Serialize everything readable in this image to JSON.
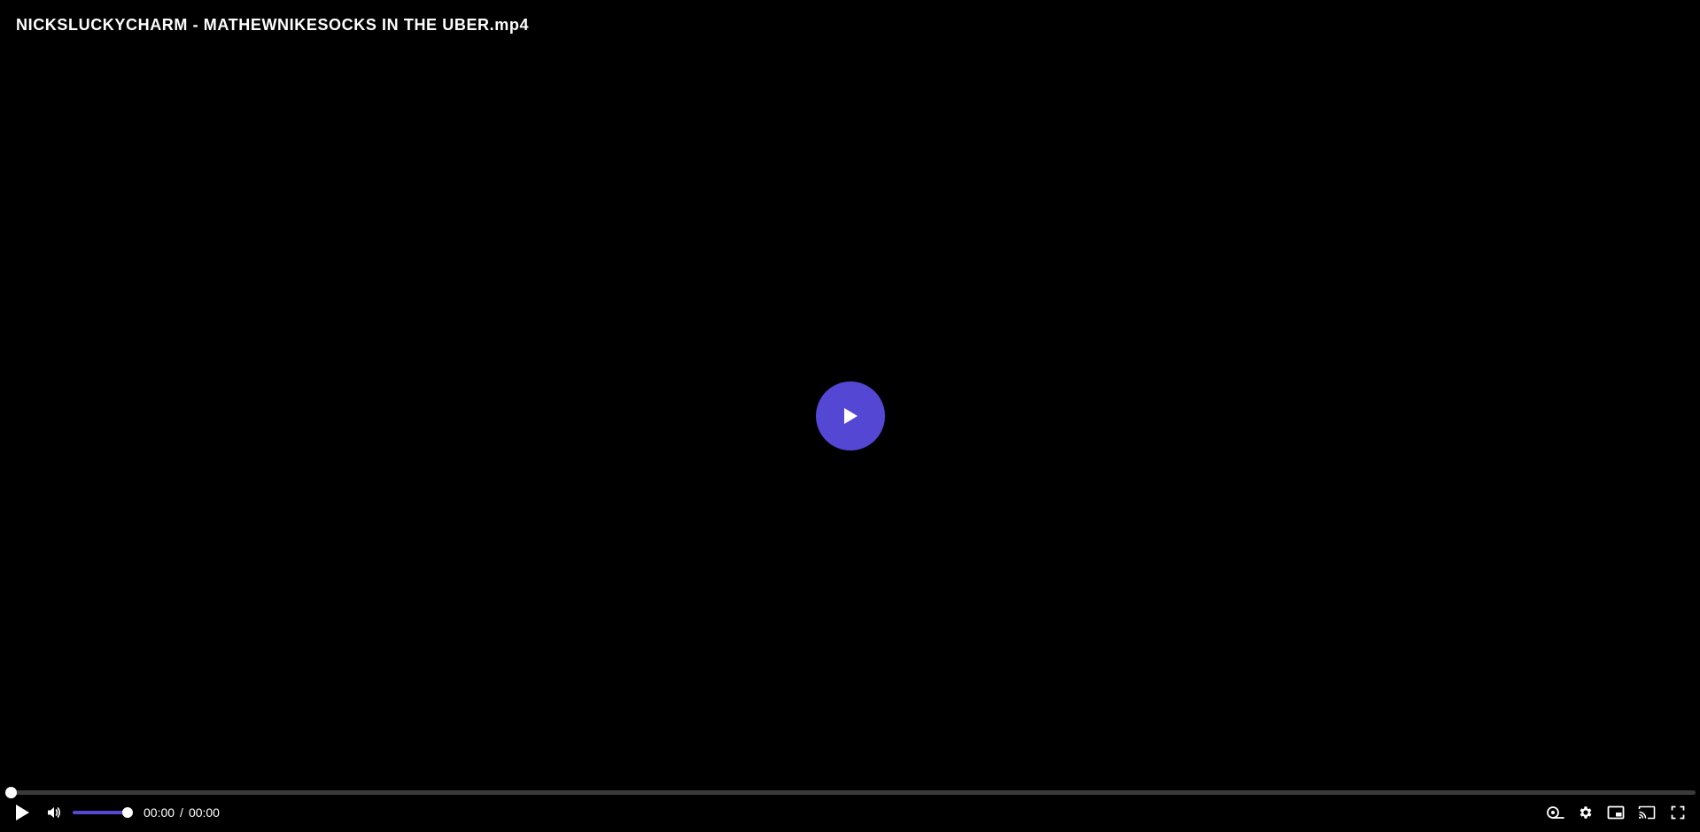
{
  "video": {
    "title": "NICKSLUCKYCHARM - MATHEWNIKESOCKS IN THE UBER.mp4"
  },
  "theme": {
    "accent": "#5447d4",
    "background": "#000000",
    "track": "#3a3a3a",
    "icon_color": "#ffffff"
  },
  "playback": {
    "state": "paused",
    "progress_fraction": 0.0
  },
  "volume": {
    "level_fraction": 1.0
  },
  "time": {
    "current": "00:00",
    "separator": "/",
    "duration": "00:00"
  },
  "icons": {
    "big_play": "play-icon",
    "play": "play-icon",
    "volume": "volume-icon",
    "captions": "captions-icon",
    "settings": "gear-icon",
    "pip": "picture-in-picture-icon",
    "cast": "cast-icon",
    "fullscreen": "fullscreen-icon"
  }
}
